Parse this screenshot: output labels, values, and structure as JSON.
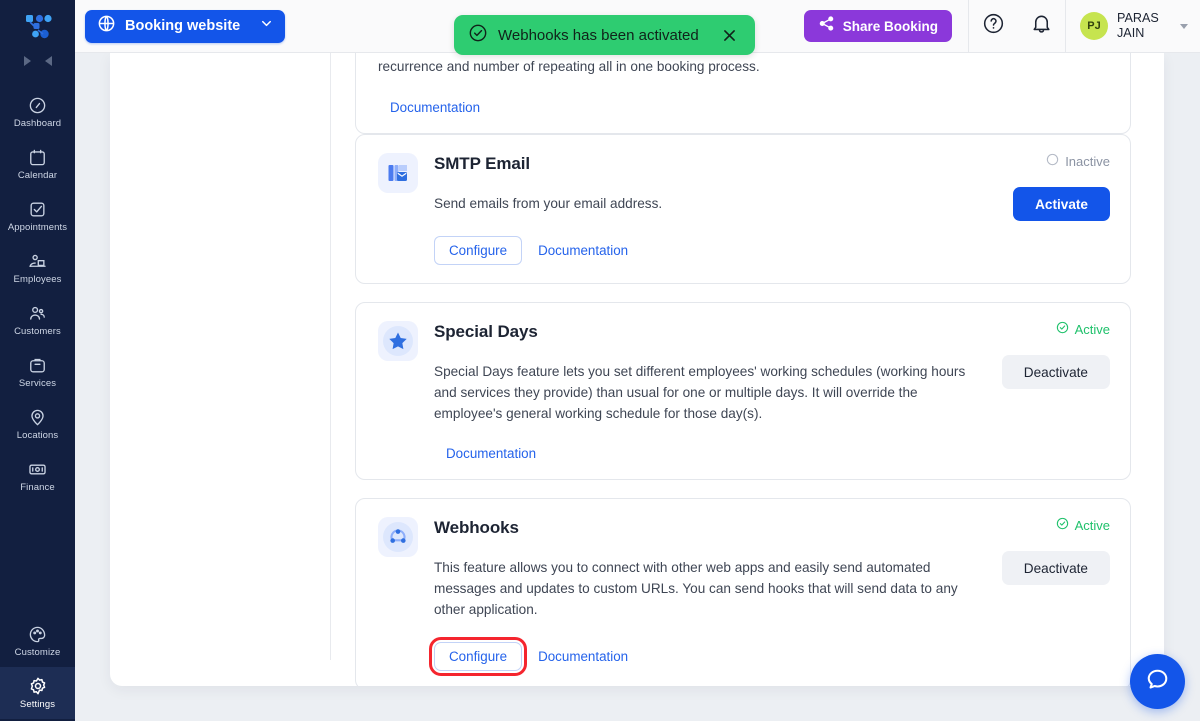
{
  "sidebar": {
    "logo_name": "trafft-logo",
    "collapse_left_icon": "arrow-left-icon",
    "collapse_right_icon": "arrow-right-icon",
    "items": [
      {
        "label": "Dashboard",
        "icon": "dashboard-icon",
        "active": false
      },
      {
        "label": "Calendar",
        "icon": "calendar-icon",
        "active": false
      },
      {
        "label": "Appointments",
        "icon": "appointments-icon",
        "active": false
      },
      {
        "label": "Employees",
        "icon": "employees-icon",
        "active": false
      },
      {
        "label": "Customers",
        "icon": "customers-icon",
        "active": false
      },
      {
        "label": "Services",
        "icon": "services-icon",
        "active": false
      },
      {
        "label": "Locations",
        "icon": "locations-icon",
        "active": false
      },
      {
        "label": "Finance",
        "icon": "finance-icon",
        "active": false
      }
    ],
    "bottom_items": [
      {
        "label": "Customize",
        "icon": "palette-icon",
        "active": false
      },
      {
        "label": "Settings",
        "icon": "gear-icon",
        "active": true
      }
    ]
  },
  "topbar": {
    "booking_website_label": "Booking website",
    "booking_website_icon": "globe-icon",
    "booking_website_caret": "chevron-down-icon",
    "share_booking_label": "Share Booking",
    "share_booking_icon": "share-icon",
    "help_icon": "question-circle-icon",
    "notifications_icon": "bell-icon",
    "user": {
      "initials": "PJ",
      "name": "PARAS JAIN",
      "name_line1": "PARAS",
      "name_line2": "JAIN",
      "caret_icon": "chevron-down-icon"
    }
  },
  "toast": {
    "message": "Webhooks has been activated",
    "check_icon": "check-circle-icon",
    "close_icon": "close-icon",
    "color": "#2ecc71"
  },
  "colors": {
    "accent_blue": "#1355e9",
    "accent_purple": "#8b38da",
    "success_green": "#1fc16b",
    "sidebar_navy": "#121f40",
    "highlight_red": "#f5252e"
  },
  "main": {
    "partial_card": {
      "clipped_text": "recurrence and number of repeating all in one booking process.",
      "documentation_label": "Documentation"
    },
    "cards": [
      {
        "id": "smtp-email",
        "icon": "smtp-email-icon",
        "title": "SMTP Email",
        "description": "Send emails from your email address.",
        "status_label": "Inactive",
        "status_state": "inactive",
        "status_icon": "circle-empty-icon",
        "cta_label": "Activate",
        "cta_kind": "activate",
        "configure_label": "Configure",
        "documentation_label": "Documentation",
        "has_configure": true,
        "highlighted": false
      },
      {
        "id": "special-days",
        "icon": "star-icon",
        "title": "Special Days",
        "description": "Special Days feature lets you set different employees' working schedules (working hours and services they provide) than usual for one or multiple days. It will override the employee's general working schedule for those day(s).",
        "status_label": "Active",
        "status_state": "active",
        "status_icon": "check-circle-icon",
        "cta_label": "Deactivate",
        "cta_kind": "deactivate",
        "configure_label": "",
        "documentation_label": "Documentation",
        "has_configure": false,
        "highlighted": false
      },
      {
        "id": "webhooks",
        "icon": "webhooks-icon",
        "title": "Webhooks",
        "description": "This feature allows you to connect with other web apps and easily send automated messages and updates to custom URLs. You can send hooks that will send data to any other application.",
        "status_label": "Active",
        "status_state": "active",
        "status_icon": "check-circle-icon",
        "cta_label": "Deactivate",
        "cta_kind": "deactivate",
        "configure_label": "Configure",
        "documentation_label": "Documentation",
        "has_configure": true,
        "highlighted": true
      }
    ]
  },
  "help_widget": {
    "icon": "chat-bubble-icon"
  }
}
